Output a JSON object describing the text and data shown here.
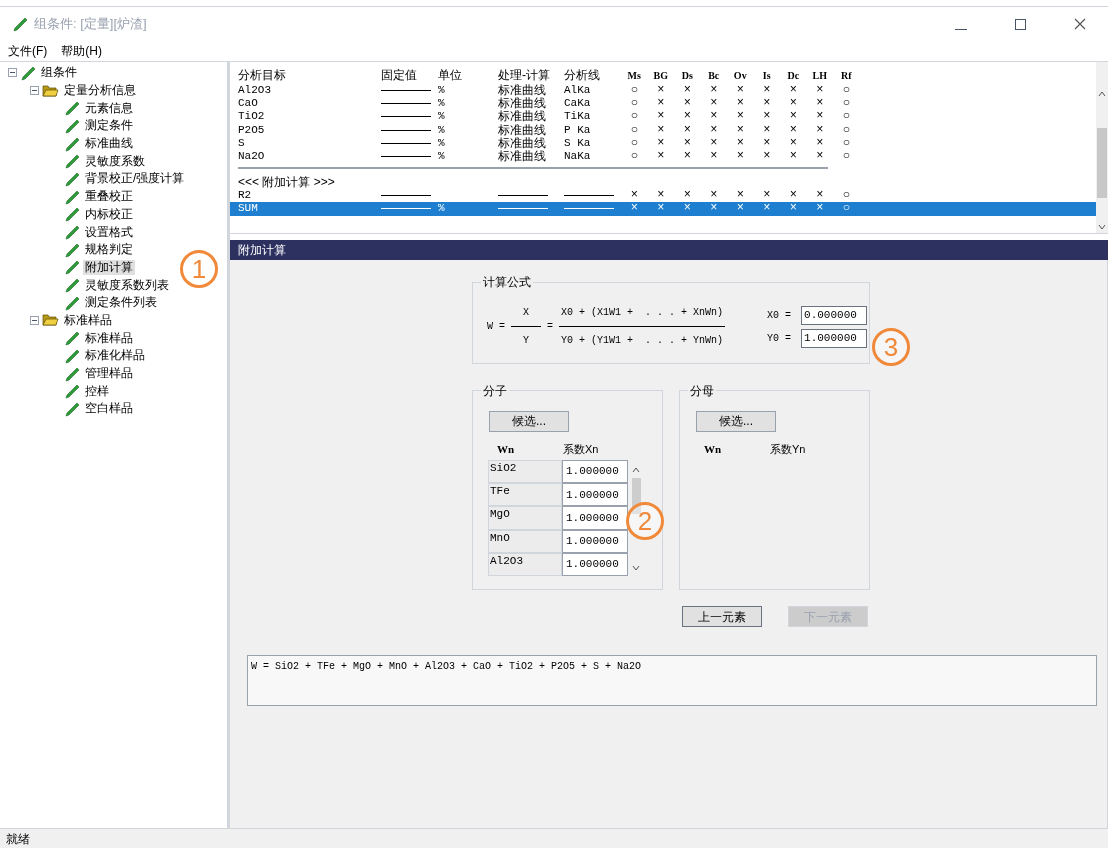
{
  "window": {
    "title": "组条件: [定量][炉渣]"
  },
  "menu": [
    "文件(F)",
    "帮助(H)"
  ],
  "tree": [
    {
      "label": "组条件",
      "expanded": true,
      "selected": false,
      "children": [
        {
          "label": "定量分析信息",
          "expanded": true,
          "selected": false,
          "children": [
            {
              "label": "元素信息",
              "selected": false
            },
            {
              "label": "测定条件",
              "selected": false
            },
            {
              "label": "标准曲线",
              "selected": false
            },
            {
              "label": "灵敏度系数",
              "selected": false
            },
            {
              "label": "背景校正/强度计算",
              "selected": false
            },
            {
              "label": "重叠校正",
              "selected": false
            },
            {
              "label": "内标校正",
              "selected": false
            },
            {
              "label": "设置格式",
              "selected": false
            },
            {
              "label": "规格判定",
              "selected": false
            },
            {
              "label": "附加计算",
              "selected": true
            },
            {
              "label": "灵敏度系数列表",
              "selected": false
            },
            {
              "label": "测定条件列表",
              "selected": false
            }
          ]
        },
        {
          "label": "标准样品",
          "expanded": true,
          "selected": false,
          "children": [
            {
              "label": "标准样品",
              "selected": false
            },
            {
              "label": "标准化样品",
              "selected": false
            },
            {
              "label": "管理样品",
              "selected": false
            },
            {
              "label": "控样",
              "selected": false
            },
            {
              "label": "空白样品",
              "selected": false
            }
          ]
        }
      ]
    }
  ],
  "table": {
    "columns": [
      "分析目标",
      "固定值",
      "单位",
      "处理-计算",
      "分析线",
      "Ms",
      "BG",
      "Ds",
      "Bc",
      "Ov",
      "Is",
      "Dc",
      "LH",
      "Rf"
    ],
    "rows": [
      {
        "kind": "data",
        "name": "Al2O3",
        "unit": "%",
        "process": "标准曲线",
        "line": "AlKa",
        "flags": [
          "○",
          "×",
          "×",
          "×",
          "×",
          "×",
          "×",
          "×",
          "○"
        ],
        "selected": false
      },
      {
        "kind": "data",
        "name": "CaO",
        "unit": "%",
        "process": "标准曲线",
        "line": "CaKa",
        "flags": [
          "○",
          "×",
          "×",
          "×",
          "×",
          "×",
          "×",
          "×",
          "○"
        ],
        "selected": false
      },
      {
        "kind": "data",
        "name": "TiO2",
        "unit": "%",
        "process": "标准曲线",
        "line": "TiKa",
        "flags": [
          "○",
          "×",
          "×",
          "×",
          "×",
          "×",
          "×",
          "×",
          "○"
        ],
        "selected": false
      },
      {
        "kind": "data",
        "name": "P2O5",
        "unit": "%",
        "process": "标准曲线",
        "line": "P Ka",
        "flags": [
          "○",
          "×",
          "×",
          "×",
          "×",
          "×",
          "×",
          "×",
          "○"
        ],
        "selected": false
      },
      {
        "kind": "data",
        "name": "S",
        "unit": "%",
        "process": "标准曲线",
        "line": "S Ka",
        "flags": [
          "○",
          "×",
          "×",
          "×",
          "×",
          "×",
          "×",
          "×",
          "○"
        ],
        "selected": false
      },
      {
        "kind": "data",
        "name": "Na2O",
        "unit": "%",
        "process": "标准曲线",
        "line": "NaKa",
        "flags": [
          "○",
          "×",
          "×",
          "×",
          "×",
          "×",
          "×",
          "×",
          "○"
        ],
        "selected": false
      },
      {
        "kind": "section",
        "name": "<<< 附加计算 >>>"
      },
      {
        "kind": "data",
        "name": "R2",
        "flags": [
          "×",
          "×",
          "×",
          "×",
          "×",
          "×",
          "×",
          "×",
          "○"
        ],
        "selected": false
      },
      {
        "kind": "data",
        "name": "SUM",
        "unit": "%",
        "flags": [
          "×",
          "×",
          "×",
          "×",
          "×",
          "×",
          "×",
          "×",
          "○"
        ],
        "selected": true
      }
    ]
  },
  "panel": {
    "title": "附加计算",
    "formula": {
      "legend": "计算公式",
      "w": "W",
      "eq1": "=",
      "x": "X",
      "y": "Y",
      "eq2": "=",
      "numerator": "X0 + (X1W1 +  . . . + XnWn)",
      "denominator": "Y0 + (Y1W1 +  . . . + YnWn)",
      "fields": [
        {
          "label": "X0 =",
          "value": "0.000000"
        },
        {
          "label": "Y0 =",
          "value": "1.000000"
        }
      ]
    },
    "groups": [
      {
        "legend": "分子",
        "button": "候选...",
        "headers": [
          "Wn",
          "系数Xn"
        ],
        "rows": [
          {
            "name": "SiO2",
            "value": "1.000000"
          },
          {
            "name": "TFe",
            "value": "1.000000"
          },
          {
            "name": "MgO",
            "value": "1.000000"
          },
          {
            "name": "MnO",
            "value": "1.000000"
          },
          {
            "name": "Al2O3",
            "value": "1.000000"
          }
        ]
      },
      {
        "legend": "分母",
        "button": "候选...",
        "headers": [
          "Wn",
          "系数Yn"
        ]
      }
    ],
    "buttons": [
      {
        "label": "上一元素",
        "disabled": false
      },
      {
        "label": "下一元素",
        "disabled": true
      }
    ],
    "result": "W = SiO2 + TFe + MgO + MnO + Al2O3 + CaO + TiO2 + P2O5 + S + Na2O"
  },
  "callouts": [
    "1",
    "2",
    "3"
  ],
  "status_bar": "就绪"
}
